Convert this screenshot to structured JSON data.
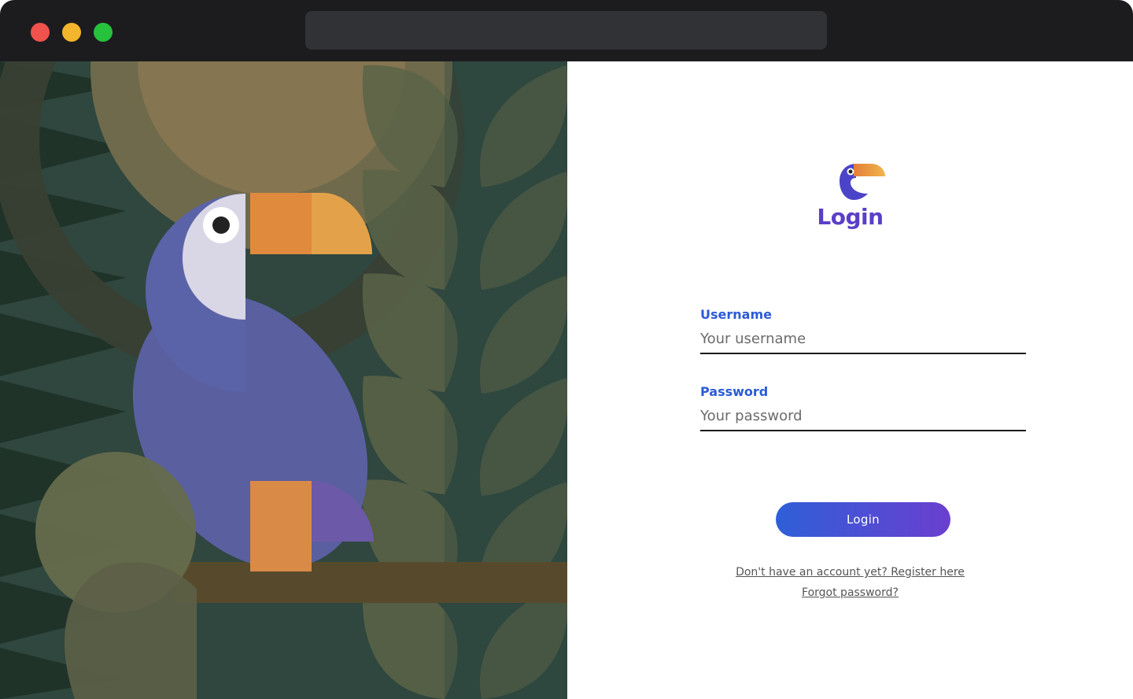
{
  "window": {
    "controls": [
      "close",
      "minimize",
      "maximize"
    ],
    "address_bar": ""
  },
  "illustration": {
    "subject": "toucan-illustration"
  },
  "login": {
    "title": "Login",
    "logo_icon": "toucan-logo-icon",
    "username": {
      "label": "Username",
      "placeholder": "Your username",
      "value": ""
    },
    "password": {
      "label": "Password",
      "placeholder": "Your password",
      "value": ""
    },
    "submit_label": "Login",
    "register_link": "Don't have an account yet? Register here",
    "forgot_link": "Forgot password?"
  },
  "colors": {
    "accent": "#5a3fc6",
    "label": "#2a5bd7",
    "button_gradient": [
      "#2f5fd8",
      "#6a3fcf"
    ]
  }
}
